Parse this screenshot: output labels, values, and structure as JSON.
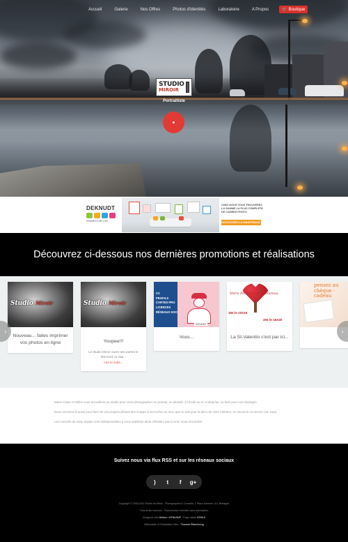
{
  "nav": {
    "items": [
      "Accueil",
      "Galerie",
      "Nos Offres",
      "Photos d'identités",
      "Laboratoire",
      "A Propos"
    ],
    "cart_label": "Boutique"
  },
  "hero": {
    "logo_line1": "STUDIO",
    "logo_line2": "MIROIR",
    "subtitle": "Portraitiste"
  },
  "banner": {
    "brand": "DEKNUDT",
    "brand_tag": "FRAMES FOR LIFE",
    "promo_text": "CHEZ NOUS VOUS TROUVEREZ LA GAMME LA PLUS COMPLETE DE CADRES PHOTO",
    "promo_button": "DECOUVREZ-LA MAINTENANT"
  },
  "section": {
    "title": "Découvrez ci-dessous nos dernières promotions et réalisations"
  },
  "cards": [
    {
      "title": "Nouveau... faites imprimer vos photos en ligne",
      "studio": "Studio",
      "mark": "Miroir"
    },
    {
      "title": "Youpee!!!",
      "studio": "Studio",
      "mark": "Miroir",
      "desc": "Le studio Miroir ouvre ses portes le Mercredi 11 Mai...",
      "more": "Lire la suite..."
    },
    {
      "title": "Vous...",
      "list": [
        "CV",
        "PROFILS",
        "CARTES PRO",
        "LICENCES",
        "RÉSEAUX SOCIAUX"
      ],
      "footer": "STUDIO"
    },
    {
      "title": "La St-Valentin c'est par ici...",
      "head": "Votre Portrait en Amoureux",
      "offer_left": "15€ le 10X15",
      "offer_right": "20€ le 15X20"
    },
    {
      "title": "",
      "head": "pensez au chèque -cadeau"
    }
  ],
  "about": [
    "Marie-Claire et Gilles vous accueillent au studio pour vous photographier en portrait, en identité, à l'école ou en entreprise, ou bien pour vos mariages.",
    "Nous sommes là aussi pour faire de vos propres photos des images à accrocher au mur, que ce soit pour la déco de votre intérieur, en souvenir ou encore une expo.",
    "Les conseils de notre équipe sont indispensables à vous satisfaire alors n'hésitez pas à venir nous rencontrer."
  ],
  "footer": {
    "title": "Suivez nous via flux RSS et sur les réseaux sociaux",
    "social_icons": [
      "rss-icon",
      "twitter-icon",
      "facebook-icon",
      "google-plus-icon"
    ],
    "copyright": "Copyright © 2006-2022 Studio du Miroir - Photographes & Conseils, 1 Place Unienne 114, Bretagne",
    "rights": "Tous droits réservés - Reproduction interdite sans autorisation",
    "designed_prefix": "Designed with",
    "designed_brands": "Hektor / HTML5UP",
    "designed_mid": "· Page valide",
    "designed_valid": "HTML5",
    "webmaster_prefix": "Webmaster et Réalisation Web :",
    "webmaster_name": "Thomas Blanchong"
  }
}
